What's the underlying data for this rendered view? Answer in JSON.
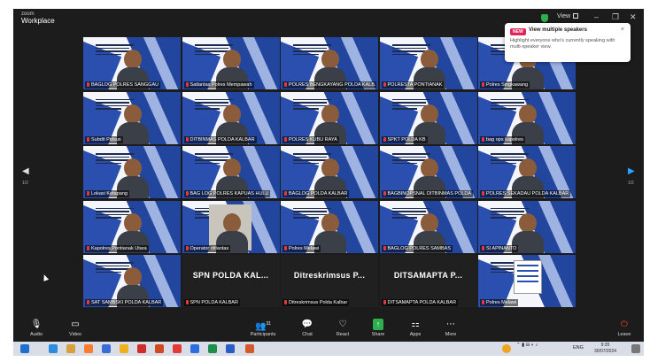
{
  "window": {
    "brand_small": "zoom",
    "brand_title": "Workplace",
    "view_label": "View",
    "minimize": "–",
    "maximize": "❐",
    "close": "✕"
  },
  "toast": {
    "badge": "NEW",
    "title": "View multiple speakers",
    "close": "×",
    "message": "Highlight everyone who's currently speaking with multi-speaker view."
  },
  "pagination": {
    "left_arrow": "◀",
    "right_arrow": "▶",
    "left_page": "1/2",
    "right_page": "1/2"
  },
  "tiles": [
    {
      "label": "BAGLOG POLRES SANGGAU",
      "kind": "video"
    },
    {
      "label": "Satlantas Polres Mempawah",
      "kind": "slide"
    },
    {
      "label": "POLRES BENGKAYANG POLDA KALB...",
      "kind": "slide"
    },
    {
      "label": "POLRESTA PONTIANAK",
      "kind": "slide"
    },
    {
      "label": "Polres Singkawang",
      "kind": "slide"
    },
    {
      "label": "Subdit Pidsus",
      "kind": "slide"
    },
    {
      "label": "DITBINMAS POLDA KALBAR",
      "kind": "slide"
    },
    {
      "label": "POLRES KUBU RAYA",
      "kind": "slide"
    },
    {
      "label": "SPKT POLDA KB",
      "kind": "video"
    },
    {
      "label": "bag ops kapolres",
      "kind": "video",
      "active": true
    },
    {
      "label": "Lokasi Ketapang",
      "kind": "slide"
    },
    {
      "label": "BAG LOG POLRES KAPUAS HULU",
      "kind": "slide"
    },
    {
      "label": "BAGLOG POLDA KALBAR",
      "kind": "slide"
    },
    {
      "label": "BAGBINOPSNAL DITBINMAS POLDA",
      "kind": "slide"
    },
    {
      "label": "POLRES SEKADAU POLDA KALBAR",
      "kind": "slide"
    },
    {
      "label": "Kapolres Pontianak Utara",
      "kind": "slide"
    },
    {
      "label": "Operator ditlantas",
      "kind": "photo"
    },
    {
      "label": "Polres Melawi",
      "kind": "slide"
    },
    {
      "label": "BAGLOG POLRES SAMBAS",
      "kind": "slide"
    },
    {
      "label": "SI APINANTO",
      "kind": "slide"
    },
    {
      "label": "SAT SAMBSKI POLDA KALBAR",
      "kind": "video"
    },
    {
      "label": "SPN POLDA KALBAR",
      "kind": "dark",
      "big": "SPN POLDA KAL..."
    },
    {
      "label": "Ditreskrimsus Polda Kalbar",
      "kind": "dark",
      "big": "Ditreskrimsus P..."
    },
    {
      "label": "DITSAMAPTA POLDA KALBAR",
      "kind": "dark",
      "big": "DITSAMAPTA P..."
    },
    {
      "label": "Polres Melawi",
      "kind": "doc"
    }
  ],
  "toolbar": {
    "audio": "Audio",
    "video": "Video",
    "participants": "Participants",
    "participants_count": "31",
    "chat": "Chat",
    "react": "React",
    "share": "Share",
    "apps": "Apps",
    "more": "More",
    "leave": "Leave"
  },
  "taskbar": {
    "lang": "ENG",
    "time": "9:35",
    "date": "30/07/2024"
  },
  "colors": {
    "accent_blue": "#2ea3ff",
    "active_speaker": "#39d353",
    "share_green": "#2fae4e",
    "new_badge": "#e0245e"
  }
}
